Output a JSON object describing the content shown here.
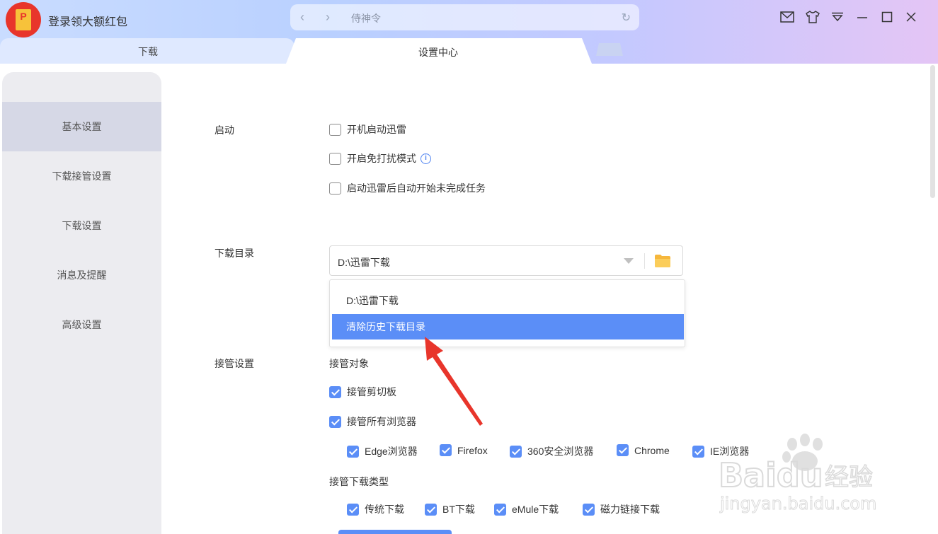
{
  "header": {
    "promo_text": "登录领大额红包",
    "logo_char": "P",
    "nav_placeholder": "侍神令"
  },
  "tabs": [
    {
      "label": "下载"
    },
    {
      "label": "设置中心"
    }
  ],
  "sidebar": {
    "items": [
      {
        "label": "基本设置",
        "active": true
      },
      {
        "label": "下载接管设置"
      },
      {
        "label": "下载设置"
      },
      {
        "label": "消息及提醒"
      },
      {
        "label": "高级设置"
      }
    ]
  },
  "startup": {
    "label": "启动",
    "options": [
      {
        "label": "开机启动迅雷",
        "checked": false
      },
      {
        "label": "开启免打扰模式",
        "checked": false
      },
      {
        "label": "启动迅雷后自动开始未完成任务",
        "checked": false
      }
    ]
  },
  "download_dir": {
    "label": "下载目录",
    "value": "D:\\迅雷下载",
    "dropdown": [
      "D:\\迅雷下载",
      "清除历史下载目录"
    ]
  },
  "takeover": {
    "label": "接管设置",
    "objects_title": "接管对象",
    "clipboard": {
      "label": "接管剪切板",
      "checked": true
    },
    "all_browsers": {
      "label": "接管所有浏览器",
      "checked": true
    },
    "browsers": [
      {
        "label": "Edge浏览器",
        "checked": true
      },
      {
        "label": "Firefox",
        "checked": true
      },
      {
        "label": "360安全浏览器",
        "checked": true
      },
      {
        "label": "Chrome",
        "checked": true
      },
      {
        "label": "IE浏览器",
        "checked": true
      }
    ],
    "types_title": "接管下载类型",
    "types": [
      {
        "label": "传统下载",
        "checked": true
      },
      {
        "label": "BT下载",
        "checked": true
      },
      {
        "label": "eMule下载",
        "checked": true
      },
      {
        "label": "磁力链接下载",
        "checked": true
      }
    ]
  },
  "watermark": {
    "brand": "Baidu",
    "product": "经验",
    "url": "jingyan.baidu.com"
  },
  "colors": {
    "accent": "#5b8ef7",
    "arrow": "#e8352b"
  }
}
